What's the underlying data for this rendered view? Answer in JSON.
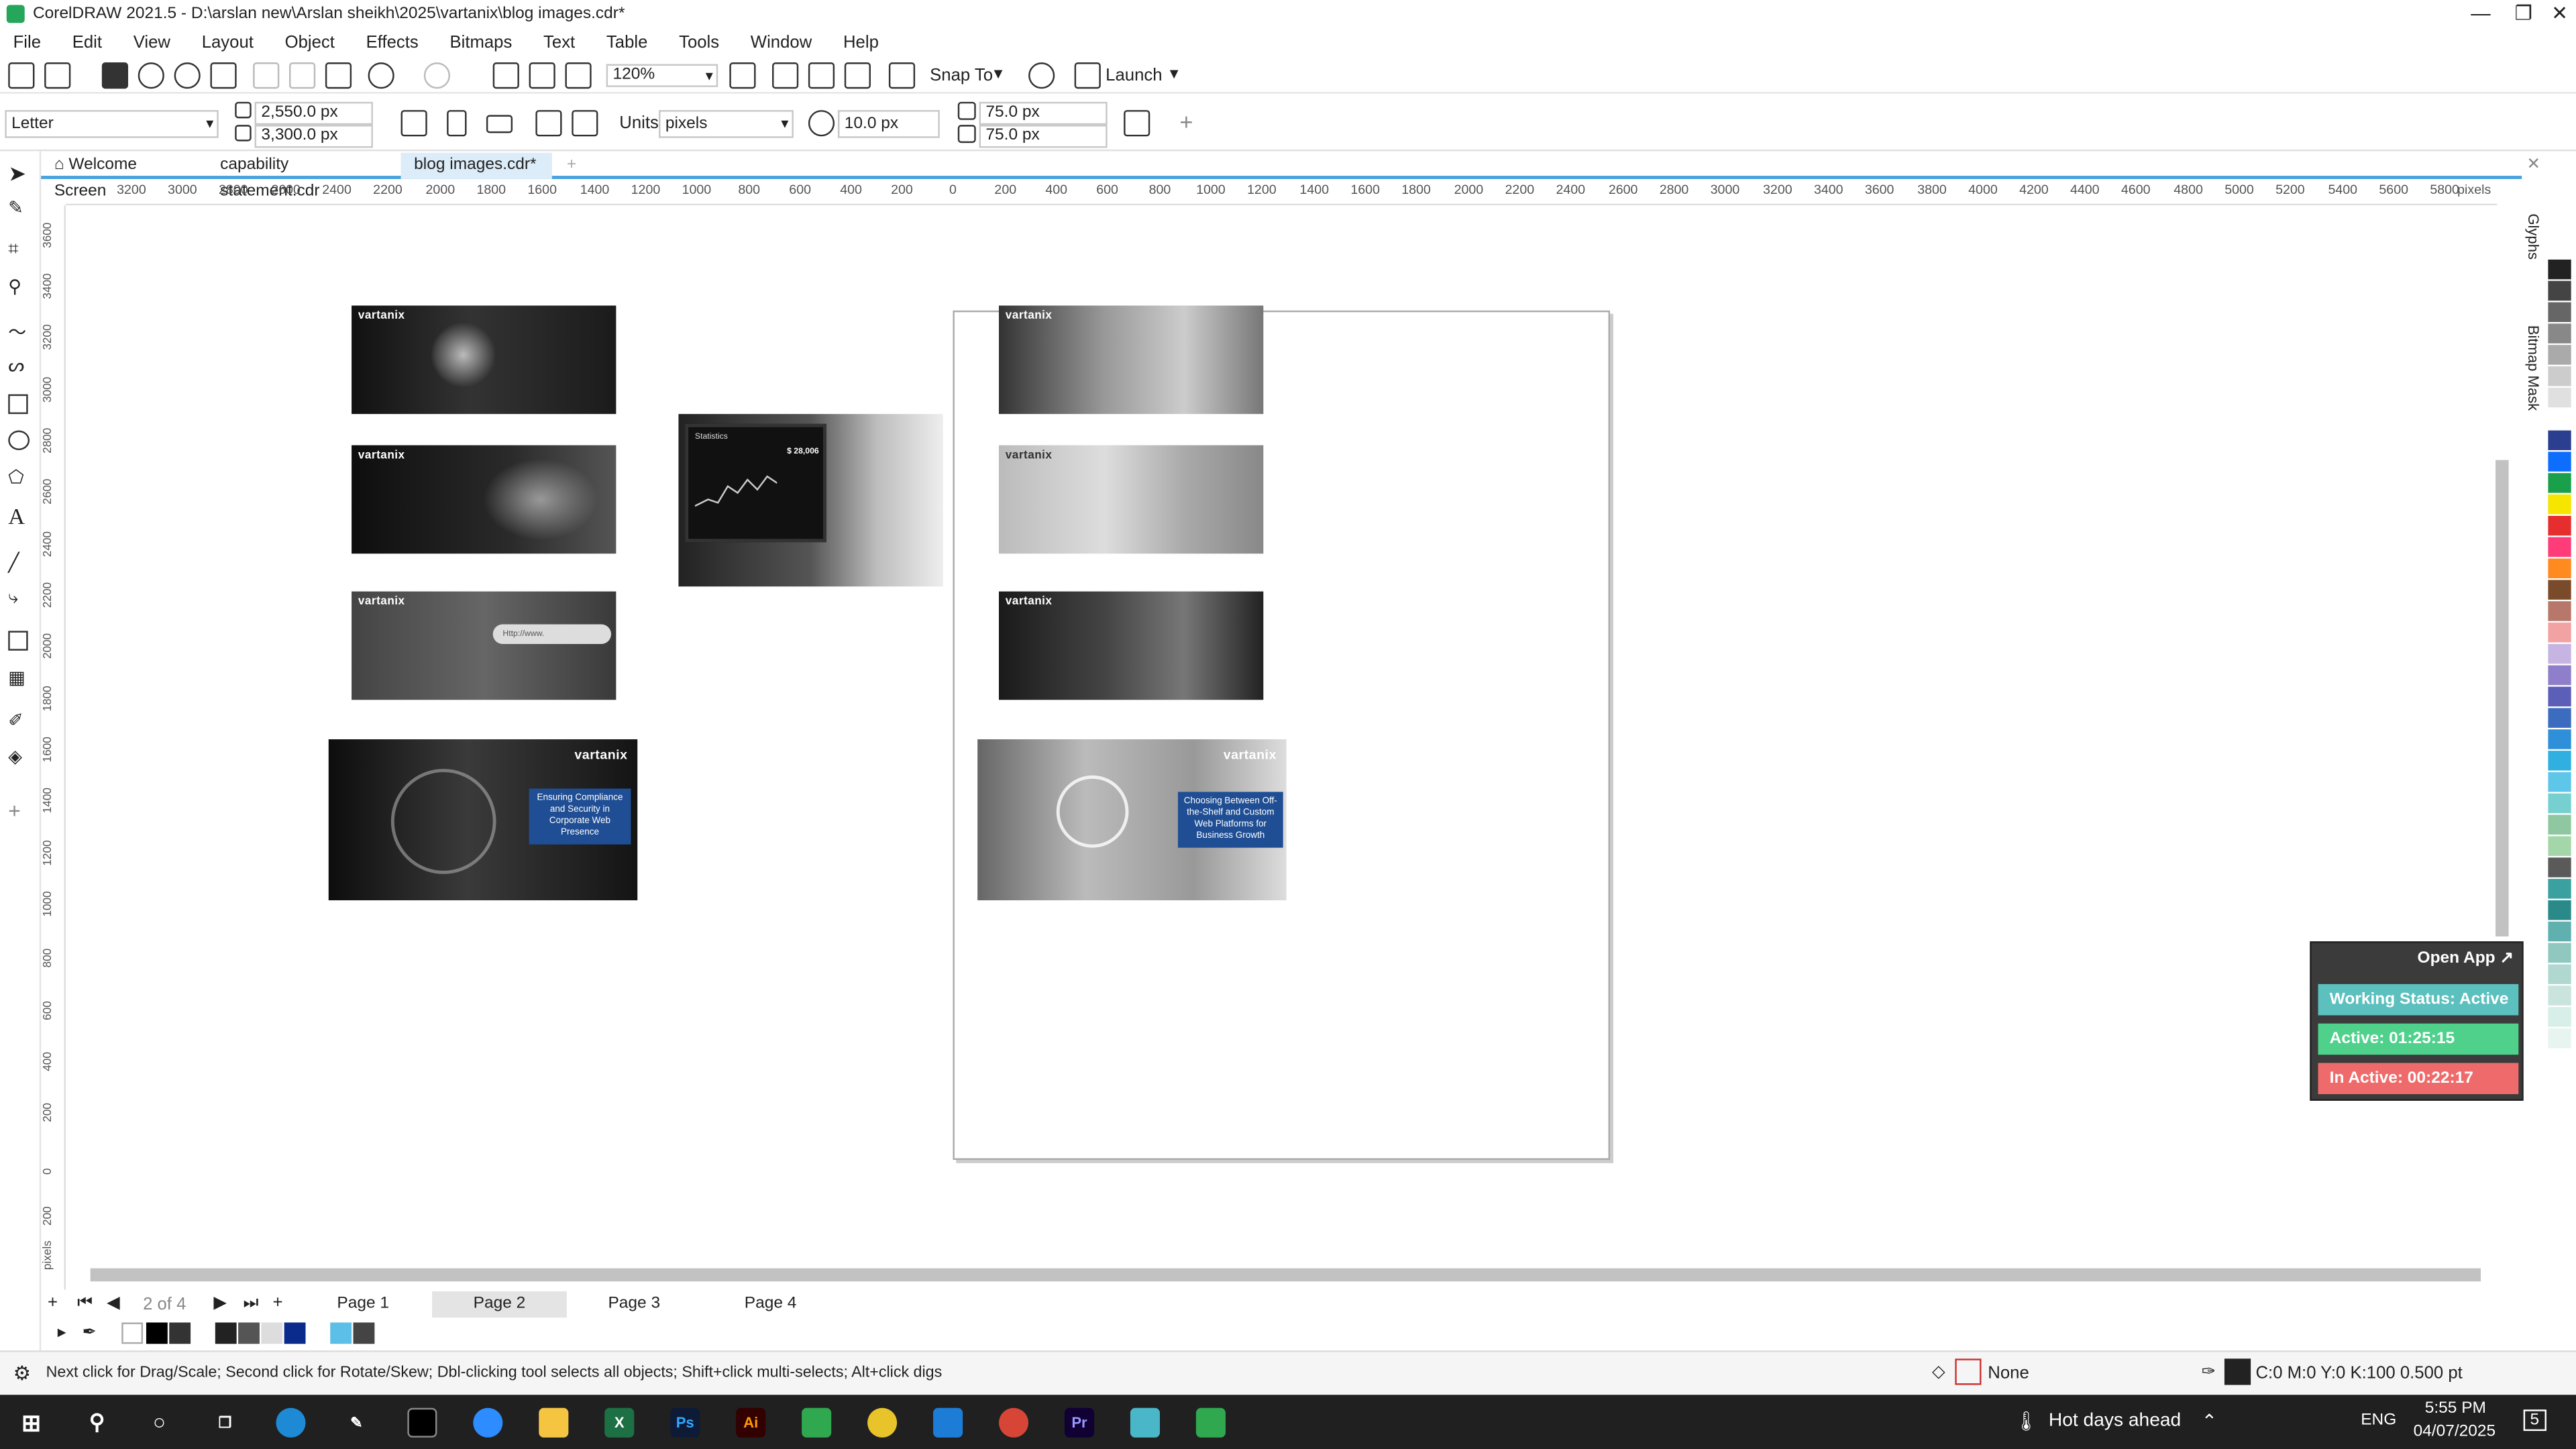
{
  "window": {
    "title": "CorelDRAW 2021.5 - D:\\arslan new\\Arslan sheikh\\2025\\vartanix\\blog images.cdr*",
    "minimize": "—",
    "maximize": "❐",
    "close": "✕"
  },
  "menu": [
    "File",
    "Edit",
    "View",
    "Layout",
    "Object",
    "Effects",
    "Bitmaps",
    "Text",
    "Table",
    "Tools",
    "Window",
    "Help"
  ],
  "toolbar": {
    "zoom": "120%",
    "snap_label": "Snap To",
    "launch_label": "Launch"
  },
  "propertybar": {
    "page_size": "Letter",
    "width": "2,550.0 px",
    "height": "3,300.0 px",
    "units_label": "Units:",
    "units_value": "pixels",
    "nudge": "10.0 px",
    "dup_x": "75.0 px",
    "dup_y": "75.0 px"
  },
  "doc_tabs": [
    "Welcome Screen",
    "capability statement.cdr",
    "blog images.cdr*"
  ],
  "ruler": {
    "h_ticks": [
      "3200",
      "3000",
      "2800",
      "2600",
      "2400",
      "2200",
      "2000",
      "1800",
      "1600",
      "1400",
      "1200",
      "1000",
      "800",
      "600",
      "400",
      "200",
      "0",
      "200",
      "400",
      "600",
      "800",
      "1000",
      "1200",
      "1400",
      "1600",
      "1800",
      "2000",
      "2200",
      "2400",
      "2600",
      "2800",
      "3000",
      "3200",
      "3400",
      "3600",
      "3800",
      "4000",
      "4200",
      "4400",
      "4600",
      "4800",
      "5000",
      "5200",
      "5400",
      "5600",
      "5800"
    ],
    "h_unit": "pixels",
    "v_ticks": [
      "3600",
      "3400",
      "3200",
      "3000",
      "2800",
      "2600",
      "2400",
      "2200",
      "2000",
      "1800",
      "1600",
      "1400",
      "1200",
      "1000",
      "800",
      "600",
      "400",
      "200",
      "0",
      "200"
    ],
    "v_unit": "pixels"
  },
  "canvas": {
    "brand": "vartanix",
    "caption_left": "Ensuring Compliance and Security in Corporate Web Presence",
    "caption_right": "Choosing Between Off-the-Shelf and Custom Web Platforms for Business Growth",
    "monitor_title": "Statistics",
    "monitor_value": "$ 28,006",
    "search_text": "Http://www."
  },
  "pages": {
    "counter": "2 of 4",
    "tabs": [
      "Page 1",
      "Page 2",
      "Page 3",
      "Page 4"
    ],
    "active": "Page 2"
  },
  "status": {
    "hint": "Next click for Drag/Scale; Second click for Rotate/Skew; Dbl-clicking tool selects all objects; Shift+click multi-selects; Alt+click digs",
    "fill": "None",
    "outline": "C:0 M:0 Y:0 K:100  0.500 pt"
  },
  "dockers": [
    "Glyphs",
    "Bitmap Mask"
  ],
  "tracker": {
    "open_app": "Open App ↗",
    "working": "Working Status: Active",
    "active": "Active: 01:25:15",
    "inactive": "In Active: 00:22:17"
  },
  "colors": {
    "working": "#5bc0be",
    "active": "#4fd18b",
    "inactive": "#ef6b6b",
    "tab_accent": "#4aa3df"
  },
  "palette": [
    "#ffffff",
    "#222222",
    "#444444",
    "#666666",
    "#888888",
    "#aaaaaa",
    "#cccccc",
    "#e0e0e0",
    "#ffffff",
    "#2b3e8f",
    "#0d6efd",
    "#1aa04a",
    "#f5e500",
    "#e62e2e",
    "#ff3c7a",
    "#ff8a1f",
    "#7a4b2a",
    "#b7776b",
    "#f2a2a2",
    "#c6b5e3",
    "#8f7ec9",
    "#5c5fb8",
    "#3b6cc0",
    "#2f8fd8",
    "#2fb0e0",
    "#5ec6e8",
    "#77d0d0",
    "#8fc8a0",
    "#a3d6a8",
    "#5a5a5a",
    "#3aa0a0",
    "#2a8a8a",
    "#60b0b0",
    "#90c8c0",
    "#b0d8d0",
    "#c8e4dc",
    "#d8eee8",
    "#e8f4f0"
  ],
  "doc_palette": [
    "#000000",
    "#333333",
    "#ffffff",
    "#222222",
    "#555555",
    "#dddddd",
    "#0a2a8c",
    "#ffffff",
    "#5bbfe8",
    "#444444"
  ],
  "taskbar": {
    "weather": "Hot days ahead",
    "lang": "ENG",
    "time": "5:55 PM",
    "date": "04/07/2025",
    "notif": "5"
  }
}
